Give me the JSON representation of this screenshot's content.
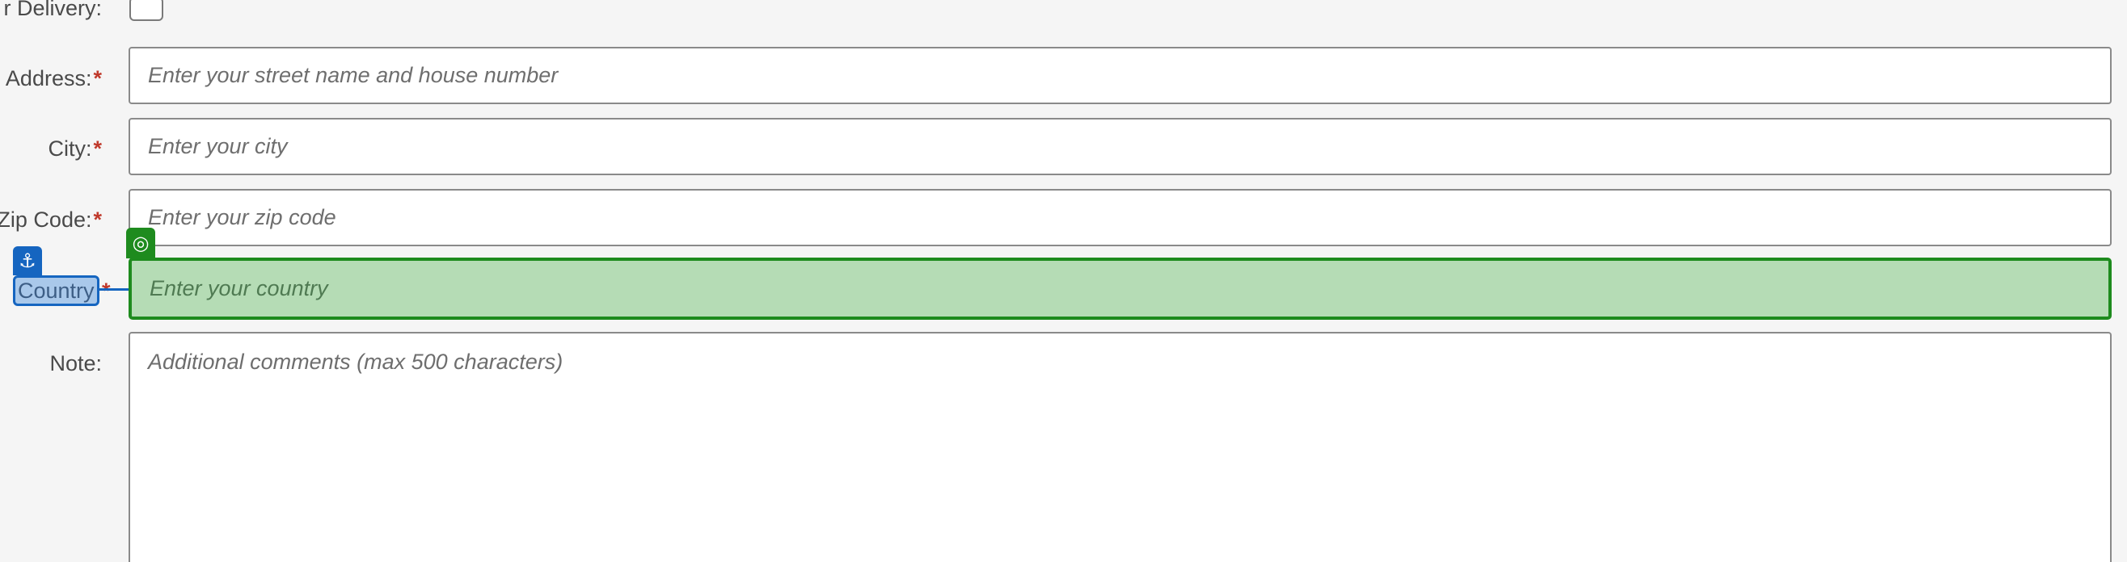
{
  "form": {
    "delivery": {
      "label": "r Delivery:"
    },
    "address": {
      "label": "Address:",
      "required_mark": "*",
      "placeholder": "Enter your street name and house number"
    },
    "city": {
      "label": "City:",
      "required_mark": "*",
      "placeholder": "Enter your city"
    },
    "zip": {
      "label": "Zip Code:",
      "required_mark": "*",
      "placeholder": "Enter your zip code"
    },
    "country": {
      "label": "Country",
      "required_mark": "*",
      "placeholder": "Enter your country"
    },
    "note": {
      "label": "Note:",
      "placeholder": "Additional comments (max 500 characters)"
    }
  },
  "overlay": {
    "target_icon": "◎",
    "anchor_icon": "⚓"
  },
  "colors": {
    "highlight_fill": "#b5dcb5",
    "highlight_border": "#1e8b1e",
    "anchor_blue": "#1565c0",
    "required_red": "#c0392b"
  }
}
